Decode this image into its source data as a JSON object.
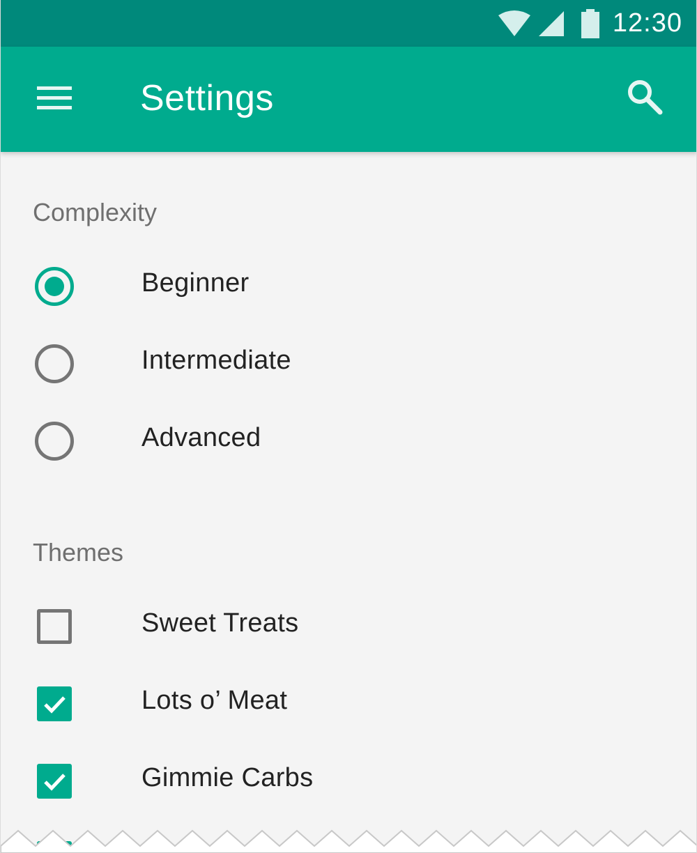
{
  "status_bar": {
    "time": "12:30",
    "icons": [
      "wifi-icon",
      "cell-signal-icon",
      "battery-icon"
    ]
  },
  "app_bar": {
    "title": "Settings",
    "menu_icon": "menu-icon",
    "search_icon": "search-icon"
  },
  "colors": {
    "status_bar": "#00897b",
    "app_bar": "#00ab8e",
    "accent": "#00ab8e",
    "background": "#f4f4f4"
  },
  "complexity": {
    "header": "Complexity",
    "options": [
      {
        "label": "Beginner",
        "selected": true
      },
      {
        "label": "Intermediate",
        "selected": false
      },
      {
        "label": "Advanced",
        "selected": false
      }
    ]
  },
  "themes": {
    "header": "Themes",
    "options": [
      {
        "label": "Sweet Treats",
        "checked": false
      },
      {
        "label": "Lots o’ Meat",
        "checked": true
      },
      {
        "label": "Gimmie Carbs",
        "checked": true
      },
      {
        "label": "",
        "checked": true
      }
    ]
  }
}
